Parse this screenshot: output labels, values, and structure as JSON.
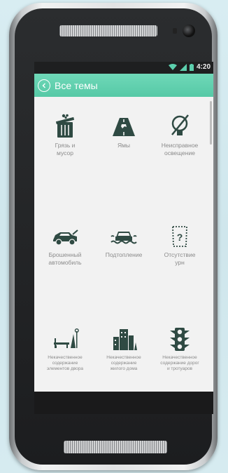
{
  "statusbar": {
    "time": "4:20"
  },
  "appbar": {
    "title": "Все темы"
  },
  "categories": [
    {
      "label": "Грязь и\nмусор",
      "icon": "trash-can-icon"
    },
    {
      "label": "Ямы",
      "icon": "road-pothole-icon"
    },
    {
      "label": "Неисправное\nосвещение",
      "icon": "broken-bulb-icon"
    },
    {
      "label": "Брошенный\nавтомобиль",
      "icon": "abandoned-car-icon"
    },
    {
      "label": "Подтопление",
      "icon": "flooded-car-icon"
    },
    {
      "label": "Отсутствие\nурн",
      "icon": "missing-bin-icon"
    },
    {
      "label": "Некачественное\nсодержание\nэлементов двора",
      "icon": "yard-bench-icon"
    },
    {
      "label": "Некачественное\nсодержание\nжилого дома",
      "icon": "apartment-building-icon"
    },
    {
      "label": "Некачественное\nсодержание дорог\nи тротуаров",
      "icon": "traffic-light-icon"
    }
  ],
  "colors": {
    "accent": "#5ccfad",
    "icon": "#2f4a43",
    "label": "#8a8a8a"
  }
}
